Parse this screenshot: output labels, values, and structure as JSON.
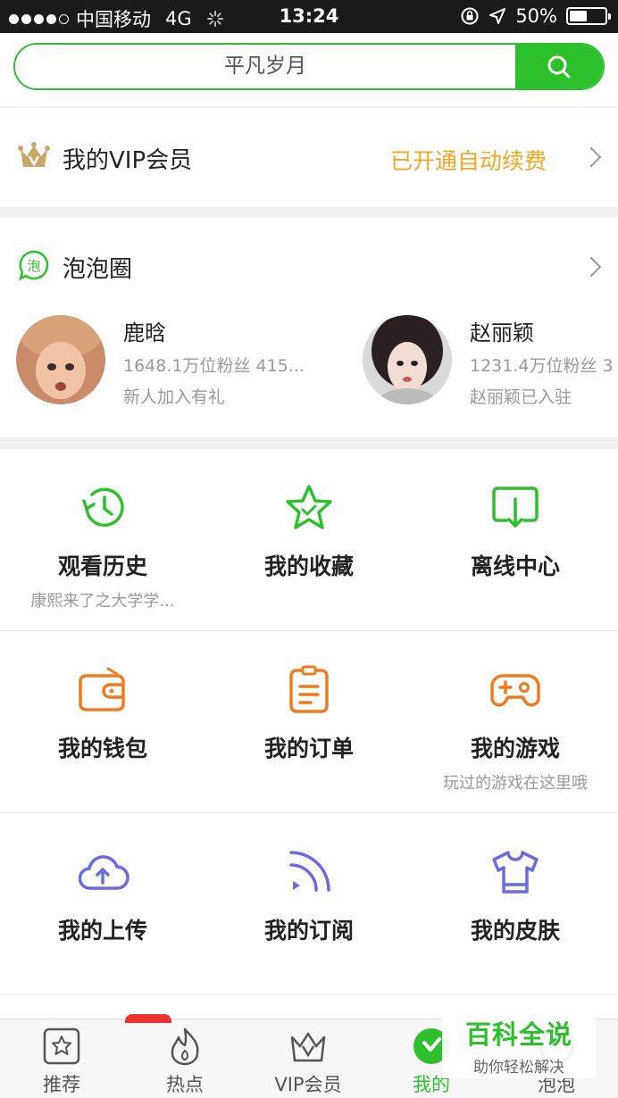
{
  "status": {
    "carrier": "中国移动",
    "network": "4G",
    "time": "13:24",
    "battery": "50%",
    "battery_level": 0.5
  },
  "search": {
    "placeholder": "平凡岁月"
  },
  "vip": {
    "title": "我的VIP会员",
    "status": "已开通自动续费",
    "accent": "#f5a623"
  },
  "bubble": {
    "title": "泡泡圈",
    "stars": [
      {
        "name": "鹿晗",
        "fans": "1648.1万位粉丝 415...",
        "note": "新人加入有礼"
      },
      {
        "name": "赵丽颖",
        "fans": "1231.4万位粉丝 3",
        "note": "赵丽颖已入驻"
      }
    ]
  },
  "grid": [
    {
      "label": "观看历史",
      "sub": "康熙来了之大学学...",
      "icon": "history-clock-icon"
    },
    {
      "label": "我的收藏",
      "sub": "",
      "icon": "star-favorite-icon"
    },
    {
      "label": "离线中心",
      "sub": "",
      "icon": "download-icon"
    },
    {
      "label": "我的钱包",
      "sub": "",
      "icon": "wallet-icon"
    },
    {
      "label": "我的订单",
      "sub": "",
      "icon": "clipboard-order-icon"
    },
    {
      "label": "我的游戏",
      "sub": "玩过的游戏在这里哦",
      "icon": "gamepad-icon"
    },
    {
      "label": "我的上传",
      "sub": "",
      "icon": "cloud-upload-icon"
    },
    {
      "label": "我的订阅",
      "sub": "",
      "icon": "rss-subscribe-icon"
    },
    {
      "label": "我的皮肤",
      "sub": "",
      "icon": "tshirt-skin-icon"
    }
  ],
  "tabs": [
    {
      "label": "推荐"
    },
    {
      "label": "热点"
    },
    {
      "label": "VIP会员"
    },
    {
      "label": "我的"
    },
    {
      "label": "泡泡"
    }
  ],
  "watermark": {
    "title": "百科全说",
    "subtitle": "助你轻松解决"
  },
  "colors": {
    "green": "#2dc02d",
    "orange": "#f07a1e",
    "purple": "#6b6be0",
    "gold": "#c8a86a"
  }
}
